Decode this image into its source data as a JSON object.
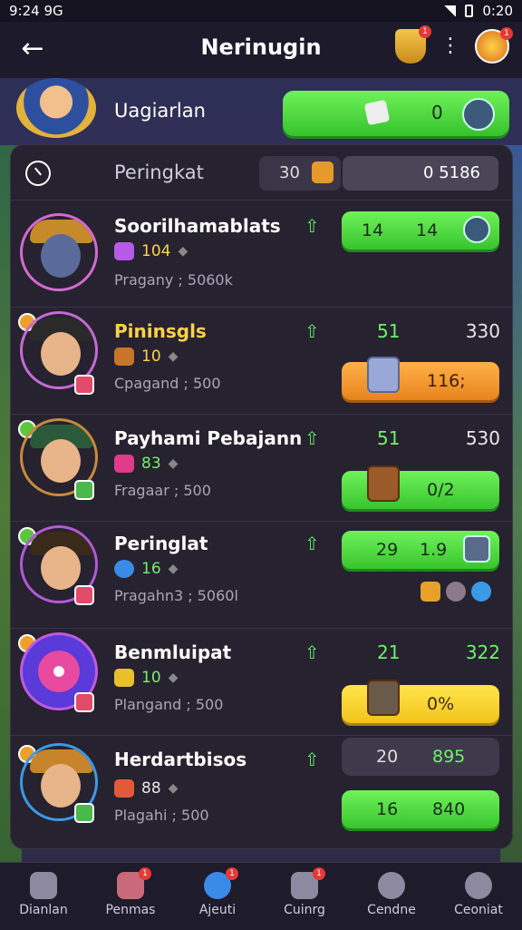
{
  "status": {
    "time": "9:24 9G",
    "right_time": "0:20"
  },
  "topbar": {
    "title": "Nerinugin",
    "back_icon": "back-arrow-icon",
    "notif_count": "1"
  },
  "hero": {
    "name": "Uagiarlan",
    "count": "0"
  },
  "panel": {
    "title": "Peringkat",
    "rank": "30",
    "score": "0 5186"
  },
  "rows": [
    {
      "name": "Soorilhamablats",
      "level": "104",
      "sub": "Pragany ; 5060k",
      "pill_left": "14",
      "pill_mid": "14",
      "pill_style": "green"
    },
    {
      "name": "Pininsgls",
      "level": "10",
      "sub": "Cpagand ; 500",
      "stat_a": "51",
      "stat_b": "330",
      "pill_text": "116;",
      "pill_style": "orange"
    },
    {
      "name": "Payhami Pebajann",
      "level": "83",
      "sub": "Fragaar ; 500",
      "stat_a": "51",
      "stat_b": "530",
      "pill_text": "0/2",
      "pill_style": "green"
    },
    {
      "name": "Peringlat",
      "level": "16",
      "sub": "Pragahn3 ; 5060l",
      "pill_left": "29",
      "pill_mid": "1.9",
      "pill_style": "green"
    },
    {
      "name": "Benmluipat",
      "level": "10",
      "sub": "Plangand ; 500",
      "stat_a": "21",
      "stat_b": "322",
      "pill_text": "0%",
      "pill_style": "yellow"
    },
    {
      "name": "Herdartbisos",
      "level": "88",
      "sub": "Plagahi ; 500",
      "stat_a": "20",
      "stat_b": "895",
      "pill_left": "16",
      "pill_mid": "840",
      "pill_style": "green"
    }
  ],
  "nav": [
    {
      "label": "Dianlan"
    },
    {
      "label": "Penmas"
    },
    {
      "label": "Ajeuti"
    },
    {
      "label": "Cuinrg"
    },
    {
      "label": "Cendne"
    },
    {
      "label": "Ceoniat"
    }
  ]
}
